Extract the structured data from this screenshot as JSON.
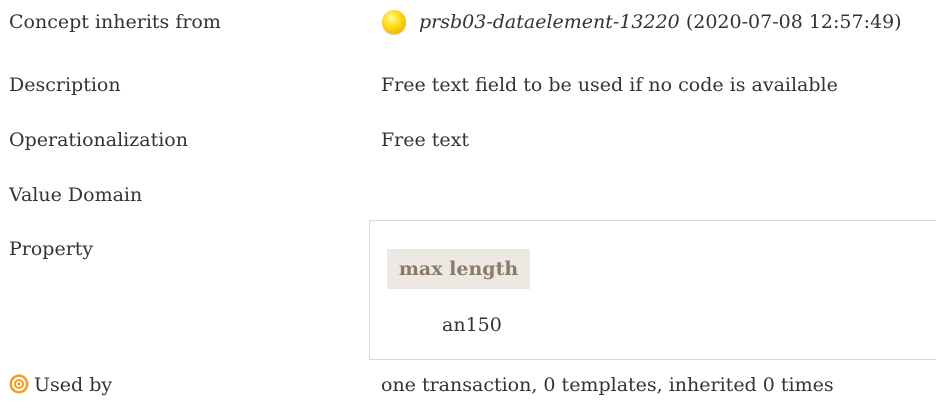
{
  "rows": {
    "concept_inherits": {
      "label": "Concept inherits from",
      "id": "prsb03-dataelement-13220",
      "date": "(2020-07-08 12:57:49)",
      "icon": "yellow-circle-icon"
    },
    "description": {
      "label": "Description",
      "value": "Free text field to be used if no code is available"
    },
    "operationalization": {
      "label": "Operationalization",
      "value": "Free text"
    },
    "value_domain": {
      "label": "Value Domain"
    },
    "property": {
      "label": "Property",
      "header": "max length",
      "value": "an150"
    },
    "used_by": {
      "label": "Used by",
      "value": "one transaction, 0 templates, inherited 0 times",
      "icon": "target-icon"
    }
  },
  "colors": {
    "text": "#333333",
    "property_header_bg": "#ede9e2",
    "property_header_text": "#8a7a68",
    "inherit_icon": "#f5b800",
    "target_icon": "#f0a020"
  }
}
